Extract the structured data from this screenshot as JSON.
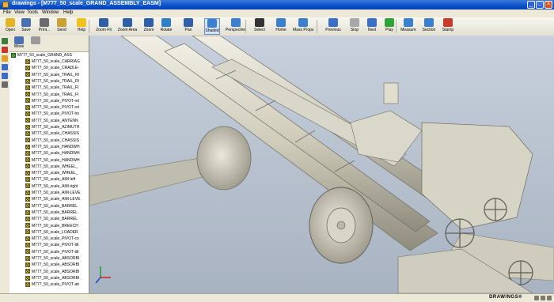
{
  "window": {
    "title": "drawings - [M777_50_scale_GRAND_ASSEMBLY_EASM]"
  },
  "menu": [
    "File",
    "View",
    "Tools",
    "Window",
    "Help"
  ],
  "toolbar": [
    {
      "label": "Open",
      "icon": "folder-open-icon",
      "color": "#e6b422"
    },
    {
      "label": "Save",
      "icon": "save-icon",
      "color": "#4a6fb3"
    },
    {
      "label": "Print...",
      "icon": "print-icon",
      "color": "#6b6b6b"
    },
    {
      "label": "Send",
      "icon": "send-mail-icon",
      "color": "#c9a236"
    },
    {
      "label": "Help",
      "icon": "help-icon",
      "color": "#f2c21a"
    },
    {
      "label": "Zoom Fit",
      "icon": "zoom-fit-icon",
      "color": "#2f5fa8"
    },
    {
      "label": "Zoom Area",
      "icon": "zoom-area-icon",
      "color": "#2f5fa8"
    },
    {
      "label": "Zoom",
      "icon": "zoom-icon",
      "color": "#2f5fa8"
    },
    {
      "label": "Rotate",
      "icon": "rotate-icon",
      "color": "#2f7fc7"
    },
    {
      "label": "Pan",
      "icon": "pan-icon",
      "color": "#2f5fa8"
    },
    {
      "label": "Shaded",
      "icon": "shaded-cube-icon",
      "color": "#3b7fcf"
    },
    {
      "label": "Perspective",
      "icon": "perspective-icon",
      "color": "#3b7fcf"
    },
    {
      "label": "Select",
      "icon": "select-arrow-icon",
      "color": "#333333"
    },
    {
      "label": "Home",
      "icon": "home-icon",
      "color": "#3b7fcf"
    },
    {
      "label": "Mass Props",
      "icon": "mass-props-icon",
      "color": "#3b7fcf"
    },
    {
      "label": "Previous",
      "icon": "previous-icon",
      "color": "#3b6fc7"
    },
    {
      "label": "Stop",
      "icon": "stop-icon",
      "color": "#a8a8a8"
    },
    {
      "label": "Next",
      "icon": "next-icon",
      "color": "#3b6fc7"
    },
    {
      "label": "Play",
      "icon": "play-icon",
      "color": "#2fa33a"
    },
    {
      "label": "Measure",
      "icon": "measure-icon",
      "color": "#3b7fcf"
    },
    {
      "label": "Section",
      "icon": "section-icon",
      "color": "#3b7fcf"
    },
    {
      "label": "Stamp",
      "icon": "stamp-icon",
      "color": "#c83a2a"
    }
  ],
  "active_tool": "Shaded",
  "panel": {
    "tools": [
      {
        "label": "Move",
        "icon": "move-icon"
      },
      {
        "label": "",
        "icon": "hide-icon"
      }
    ],
    "root": "M777_50_scale_GRAND_ASS",
    "items": [
      "M777_50_scale_CARRIAG",
      "M777_50_scale_CRADLE-",
      "M777_50_scale_TRAIL_RI",
      "M777_50_scale_TRAIL_RI",
      "M777_50_scale_TRAIL_FI",
      "M777_50_scale_TRAIL_FI",
      "M777_50_scale_PIVOT-rel",
      "M777_50_scale_PIVOT-rel",
      "M777_50_scale_PIVOT-ho",
      "M777_50_scale_ANTENN",
      "M777_50_scale_AZIMUTH",
      "M777_50_scale_CHASSIS",
      "M777_50_scale_CHASSIS",
      "M777_50_scale_HANDWH",
      "M777_50_scale_HANDWH",
      "M777_50_scale_HANDWH",
      "M777_50_scale_WHEEL_",
      "M777_50_scale_WHEEL_",
      "M777_50_scale_AIM-left",
      "M777_50_scale_AIM-right",
      "M777_50_scale_AIM-LEVE",
      "M777_50_scale_AIM-LEVE",
      "M777_50_scale_BARREL",
      "M777_50_scale_BARREL",
      "M777_50_scale_BARREL",
      "M777_50_scale_BREECH",
      "M777_50_scale_LOADER",
      "M777_50_scale_PIVOT-co",
      "M777_50_scale_PIVOT-tilt",
      "M777_50_scale_PIVOT-tilt",
      "M777_50_scale_ABSORBI",
      "M777_50_scale_ABSORBI",
      "M777_50_scale_ABSORBI",
      "M777_50_scale_ABSORBI",
      "M777_50_scale_PIVOT-ab"
    ]
  },
  "status": {
    "brand": "DRAWINGS®"
  },
  "colors": {
    "viewport_bg": "#b9c4d1",
    "model": "#d6d4c4",
    "title_bar": "#0a4fcc"
  }
}
